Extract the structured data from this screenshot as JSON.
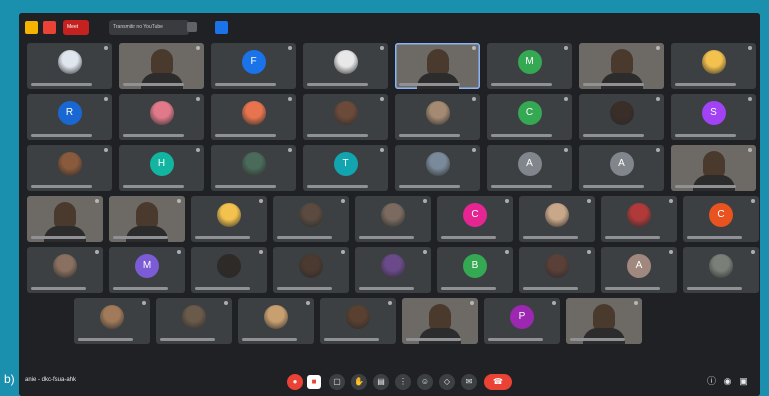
{
  "caption": "b)",
  "browser": {
    "tab_meet_label": "Meet",
    "tab_youtube_label": "Transmitir no YouTube"
  },
  "meeting": {
    "code": "anie - dkc-fsua-ahk"
  },
  "controls": {
    "mic_icon": "mic-off-icon",
    "end_call_icon": "call-end-icon"
  },
  "colors": {
    "background": "#202124",
    "tile": "#3c4043",
    "end_call": "#ea4335",
    "frame": "#1b8fae"
  },
  "tiles": [
    {
      "kind": "pic",
      "color": "#dfe6ee"
    },
    {
      "kind": "cam"
    },
    {
      "kind": "letter",
      "letter": "F",
      "color": "#1a73e8"
    },
    {
      "kind": "pic",
      "color": "#e8e8e8"
    },
    {
      "kind": "cam",
      "active": true
    },
    {
      "kind": "letter",
      "letter": "M",
      "color": "#34a853"
    },
    {
      "kind": "cam"
    },
    {
      "kind": "pic",
      "color": "#f2c14e"
    },
    {
      "kind": "letter",
      "letter": "R",
      "color": "#1967d2"
    },
    {
      "kind": "pic",
      "color": "#e07a8a"
    },
    {
      "kind": "pic",
      "color": "#e8744f"
    },
    {
      "kind": "pic",
      "color": "#6b4a3a"
    },
    {
      "kind": "pic",
      "color": "#a58a73"
    },
    {
      "kind": "letter",
      "letter": "C",
      "color": "#34a853"
    },
    {
      "kind": "pic",
      "color": "#3a2e28"
    },
    {
      "kind": "letter",
      "letter": "S",
      "color": "#a142f4"
    },
    {
      "kind": "pic",
      "color": "#8a5a3c"
    },
    {
      "kind": "letter",
      "letter": "H",
      "color": "#12b5a0"
    },
    {
      "kind": "pic",
      "color": "#4a6a5a"
    },
    {
      "kind": "letter",
      "letter": "T",
      "color": "#12a4af"
    },
    {
      "kind": "pic",
      "color": "#7a8a9a"
    },
    {
      "kind": "letter",
      "letter": "A",
      "color": "#80868b"
    },
    {
      "kind": "letter",
      "letter": "A",
      "color": "#80868b"
    },
    {
      "kind": "cam"
    },
    {
      "kind": "cam"
    },
    {
      "kind": "cam"
    },
    {
      "kind": "pic",
      "color": "#f2c14e"
    },
    {
      "kind": "pic",
      "color": "#5a4a40"
    },
    {
      "kind": "pic",
      "color": "#7a6a60"
    },
    {
      "kind": "letter",
      "letter": "C",
      "color": "#e52592"
    },
    {
      "kind": "pic",
      "color": "#c9a88a"
    },
    {
      "kind": "pic",
      "color": "#b03a3a"
    },
    {
      "kind": "letter",
      "letter": "C",
      "color": "#e8531f"
    },
    {
      "kind": "pic",
      "color": "#8a7060"
    },
    {
      "kind": "letter",
      "letter": "M",
      "color": "#7b5cd6"
    },
    {
      "kind": "pic",
      "color": "#2e2a28"
    },
    {
      "kind": "pic",
      "color": "#4a3a30"
    },
    {
      "kind": "pic",
      "color": "#6a4a8a"
    },
    {
      "kind": "letter",
      "letter": "B",
      "color": "#34a853"
    },
    {
      "kind": "pic",
      "color": "#5a4038"
    },
    {
      "kind": "letter",
      "letter": "A",
      "color": "#a1887f"
    },
    {
      "kind": "pic",
      "color": "#7a8078"
    },
    {
      "kind": "pic",
      "color": "#a07a5a"
    },
    {
      "kind": "pic",
      "color": "#6a5a4a"
    },
    {
      "kind": "pic",
      "color": "#c8a070"
    },
    {
      "kind": "pic",
      "color": "#5a4030"
    },
    {
      "kind": "cam"
    },
    {
      "kind": "letter",
      "letter": "P",
      "color": "#9c27b0"
    },
    {
      "kind": "cam"
    }
  ]
}
